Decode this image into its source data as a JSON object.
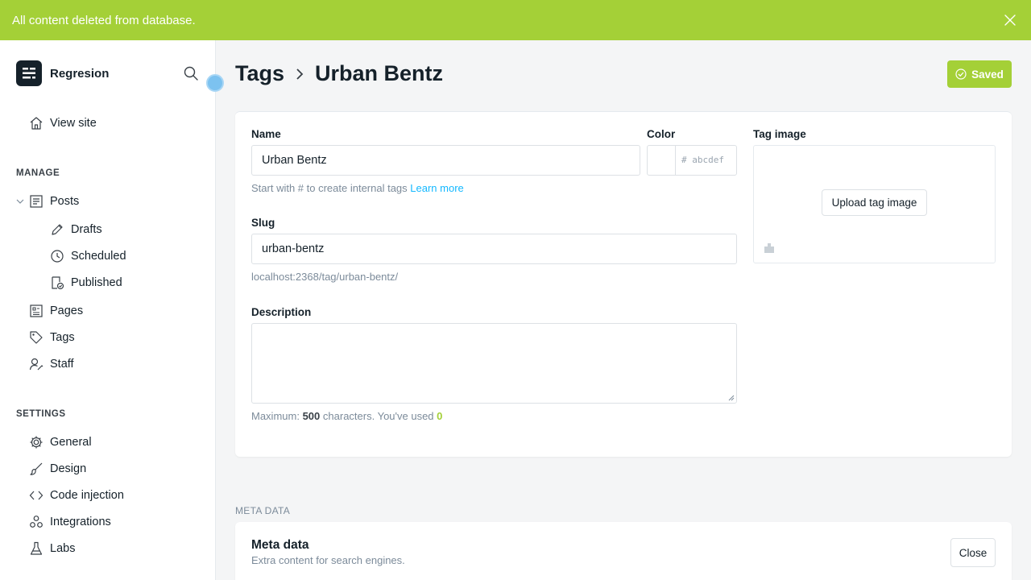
{
  "notification": {
    "message": "All content deleted from database."
  },
  "sidebar": {
    "brand": "Regresion",
    "view_site": "View site",
    "manage_label": "MANAGE",
    "posts": "Posts",
    "drafts": "Drafts",
    "scheduled": "Scheduled",
    "published": "Published",
    "pages": "Pages",
    "tags": "Tags",
    "staff": "Staff",
    "settings_label": "SETTINGS",
    "general": "General",
    "design": "Design",
    "code_injection": "Code injection",
    "integrations": "Integrations",
    "labs": "Labs"
  },
  "header": {
    "breadcrumb_parent": "Tags",
    "breadcrumb_current": "Urban Bentz",
    "saved_label": "Saved"
  },
  "form": {
    "name_label": "Name",
    "name_value": "Urban Bentz",
    "name_hint": "Start with # to create internal tags",
    "learn_more": "Learn more",
    "color_label": "Color",
    "color_placeholder": "# abcdef",
    "tag_image_label": "Tag image",
    "upload_label": "Upload tag image",
    "slug_label": "Slug",
    "slug_value": "urban-bentz",
    "slug_url": "localhost:2368/tag/urban-bentz/",
    "description_label": "Description",
    "desc_hint_prefix": "Maximum:",
    "desc_max": "500",
    "desc_hint_middle": "characters. You've used",
    "desc_used": "0"
  },
  "meta": {
    "section_label": "META DATA",
    "title": "Meta data",
    "subtitle": "Extra content for search engines.",
    "close_label": "Close"
  },
  "colors": {
    "accent_green": "#a4d037",
    "link_blue": "#14b8ff"
  }
}
